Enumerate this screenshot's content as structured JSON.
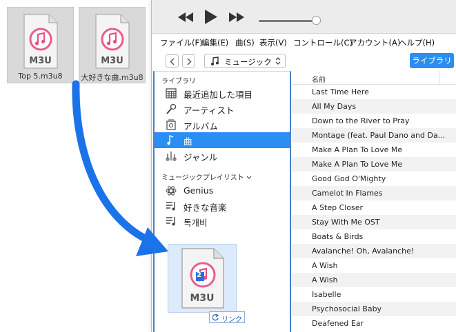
{
  "desktop_files": [
    {
      "name": "Top 5.m3u8",
      "badge": "M3U"
    },
    {
      "name": "大好きな曲.m3u8",
      "badge": "M3U"
    }
  ],
  "menu": [
    "ファイル(F)",
    "編集(E)",
    "曲(S)",
    "表示(V)",
    "コントロール(C)",
    "アカウント(A)",
    "ヘルプ(H)"
  ],
  "toolbar": {
    "source": "ミュージック",
    "library_button": "ライブラリ"
  },
  "sidebar": {
    "library_label": "ライブラリ",
    "library_items": [
      "最近追加した項目",
      "アーティスト",
      "アルバム",
      "曲",
      "ジャンル"
    ],
    "playlists_label": "ミュージックプレイリスト",
    "playlists": [
      "Genius",
      "好きな音楽",
      "독개비"
    ]
  },
  "list": {
    "column": "名前",
    "songs": [
      "Last Time Here",
      "All My Days",
      "Down to the River to Pray",
      "Montage (feat. Paul Dano and Da...",
      "Make A Plan To Love Me",
      "Make A Plan To Love Me",
      "Good God O'Mighty",
      "Camelot In Flames",
      "A Step Closer",
      "Stay With Me OST",
      "Boats & Birds",
      "Avalanche! Oh, Avalanche!",
      "A Wish",
      "A Wish",
      "Isabelle",
      "Psychosocial Baby",
      "Deafened Ear"
    ]
  },
  "drag": {
    "badge": "M3U",
    "count": "2",
    "link_label": "リンク"
  },
  "colors": {
    "accent": "#2b8ef3",
    "arrow": "#1a73e8",
    "sidebar_border": "#4a80c9"
  }
}
